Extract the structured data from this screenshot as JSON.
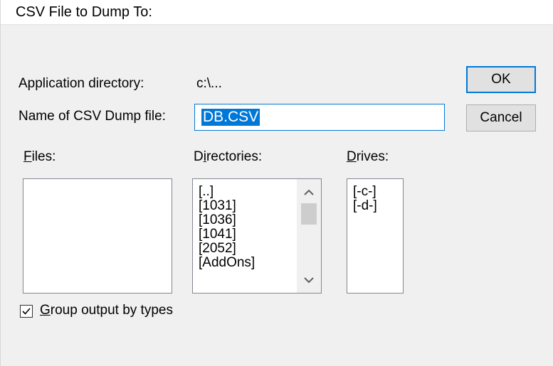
{
  "window": {
    "title": "CSV File to Dump To:"
  },
  "form": {
    "app_dir_label": "Application directory:",
    "app_dir_value": "c:\\...",
    "dump_name_label": "Name of CSV Dump file:",
    "dump_name_value": "DB.CSV"
  },
  "buttons": {
    "ok": "OK",
    "cancel": "Cancel"
  },
  "files": {
    "label_accel": "F",
    "label_rest": "iles:",
    "items": []
  },
  "directories": {
    "label_pre": "D",
    "label_accel": "i",
    "label_rest": "rectories:",
    "items": [
      "[..]",
      "[1031]",
      "[1036]",
      "[1041]",
      "[2052]",
      "[AddOns]"
    ]
  },
  "drives": {
    "label_accel": "D",
    "label_rest": "rives:",
    "items": [
      "[-c-]",
      "[-d-]"
    ]
  },
  "group_output": {
    "checked": true,
    "label_accel": "G",
    "label_rest": "roup output by types"
  },
  "icons": {
    "scroll_up": "chevron-up-icon",
    "scroll_down": "chevron-down-icon",
    "check": "check-icon"
  }
}
